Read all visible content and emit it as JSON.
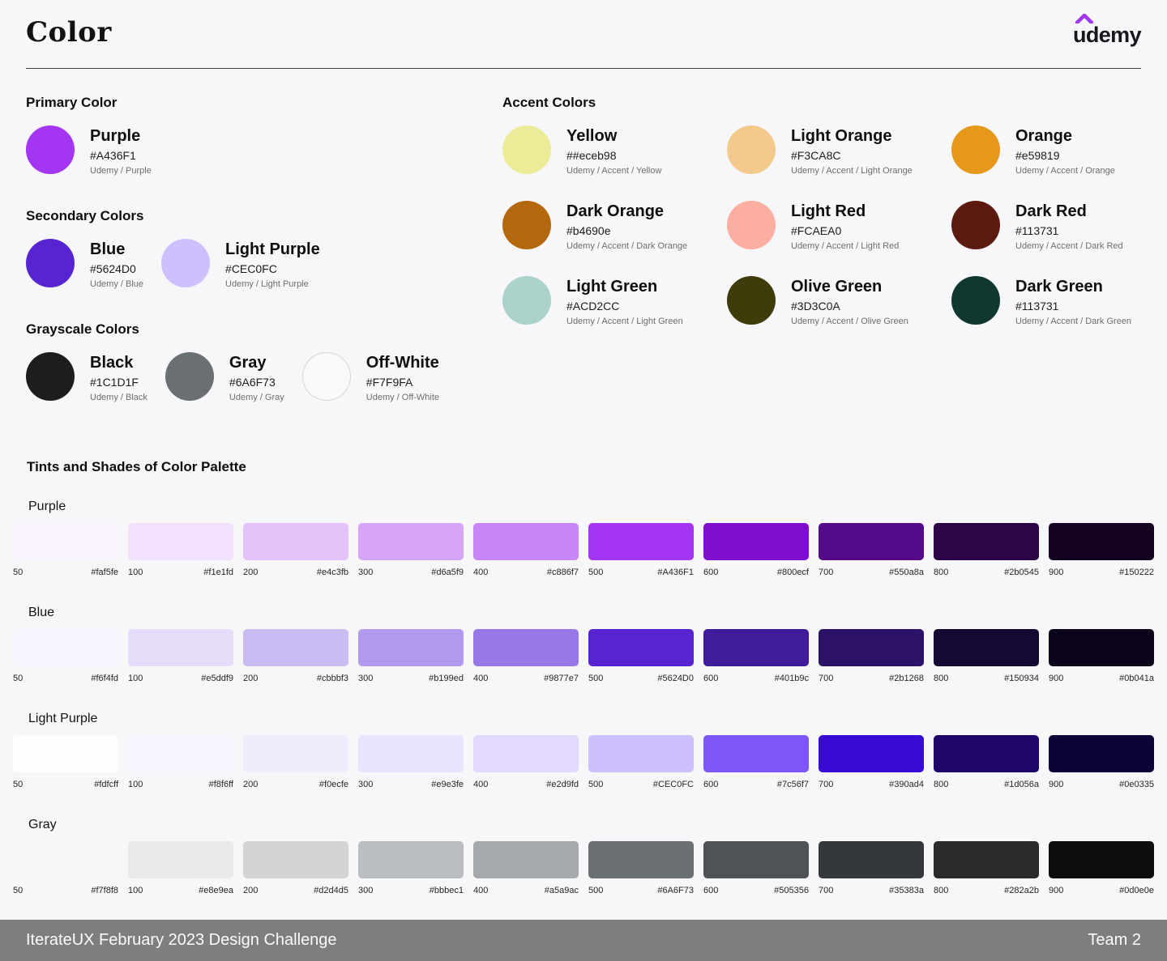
{
  "page": {
    "title": "Color"
  },
  "logo": {
    "wordmark": "udemy",
    "caret_color": "#A435F0"
  },
  "primary": {
    "heading": "Primary Color",
    "colors": [
      {
        "name": "Purple",
        "hex": "#A436F1",
        "swatch": "#A436F1",
        "path": "Udemy / Purple"
      }
    ]
  },
  "secondary": {
    "heading": "Secondary Colors",
    "colors": [
      {
        "name": "Blue",
        "hex": "#5624D0",
        "swatch": "#5624D0",
        "path": "Udemy / Blue"
      },
      {
        "name": "Light Purple",
        "hex": "#CEC0FC",
        "swatch": "#CEC0FC",
        "path": "Udemy / Light Purple"
      }
    ]
  },
  "grayscale": {
    "heading": "Grayscale Colors",
    "colors": [
      {
        "name": "Black",
        "hex": "#1C1D1F",
        "swatch": "#1C1D1F",
        "path": "Udemy / Black"
      },
      {
        "name": "Gray",
        "hex": "#6A6F73",
        "swatch": "#6A6F73",
        "path": "Udemy / Gray"
      },
      {
        "name": "Off-White",
        "hex": "#F7F9FA",
        "swatch": "#F7F9FA",
        "path": "Udemy / Off-White",
        "border": "#d5d7d9"
      }
    ]
  },
  "accent": {
    "heading": "Accent Colors",
    "colors": [
      {
        "name": "Yellow",
        "hex": "##eceb98",
        "swatch": "#eceb98",
        "path": "Udemy / Accent / Yellow"
      },
      {
        "name": "Light Orange",
        "hex": "#F3CA8C",
        "swatch": "#F3CA8C",
        "path": "Udemy / Accent / Light Orange"
      },
      {
        "name": "Orange",
        "hex": "#e59819",
        "swatch": "#e59819",
        "path": "Udemy / Accent / Orange"
      },
      {
        "name": "Dark Orange",
        "hex": "#b4690e",
        "swatch": "#b4690e",
        "path": "Udemy / Accent / Dark Orange"
      },
      {
        "name": "Light Red",
        "hex": "#FCAEA0",
        "swatch": "#FCAEA0",
        "path": "Udemy / Accent / Light Red"
      },
      {
        "name": "Dark Red",
        "hex": "#113731",
        "swatch": "#5b1b10",
        "path": "Udemy / Accent / Dark Red"
      },
      {
        "name": "Light Green",
        "hex": "#ACD2CC",
        "swatch": "#ACD2CC",
        "path": "Udemy / Accent / Light Green"
      },
      {
        "name": "Olive Green",
        "hex": "#3D3C0A",
        "swatch": "#3D3C0A",
        "path": "Udemy / Accent / Olive Green"
      },
      {
        "name": "Dark Green",
        "hex": "#113731",
        "swatch": "#113731",
        "path": "Udemy / Accent / Dark Green"
      }
    ]
  },
  "tints": {
    "heading": "Tints and Shades of Color Palette",
    "rows": [
      {
        "name": "Purple",
        "steps": [
          {
            "scale": "50",
            "hex": "#faf5fe"
          },
          {
            "scale": "100",
            "hex": "#f1e1fd"
          },
          {
            "scale": "200",
            "hex": "#e4c3fb"
          },
          {
            "scale": "300",
            "hex": "#d6a5f9"
          },
          {
            "scale": "400",
            "hex": "#c886f7"
          },
          {
            "scale": "500",
            "hex": "#A436F1"
          },
          {
            "scale": "600",
            "hex": "#800ecf"
          },
          {
            "scale": "700",
            "hex": "#550a8a"
          },
          {
            "scale": "800",
            "hex": "#2b0545"
          },
          {
            "scale": "900",
            "hex": "#150222"
          }
        ]
      },
      {
        "name": "Blue",
        "steps": [
          {
            "scale": "50",
            "hex": "#f6f4fd"
          },
          {
            "scale": "100",
            "hex": "#e5ddf9"
          },
          {
            "scale": "200",
            "hex": "#cbbbf3"
          },
          {
            "scale": "300",
            "hex": "#b199ed"
          },
          {
            "scale": "400",
            "hex": "#9877e7"
          },
          {
            "scale": "500",
            "hex": "#5624D0"
          },
          {
            "scale": "600",
            "hex": "#401b9c"
          },
          {
            "scale": "700",
            "hex": "#2b1268"
          },
          {
            "scale": "800",
            "hex": "#150934"
          },
          {
            "scale": "900",
            "hex": "#0b041a"
          }
        ]
      },
      {
        "name": "Light Purple",
        "steps": [
          {
            "scale": "50",
            "hex": "#fdfcff"
          },
          {
            "scale": "100",
            "hex": "#f8f6ff"
          },
          {
            "scale": "200",
            "hex": "#f0ecfe"
          },
          {
            "scale": "300",
            "hex": "#e9e3fe"
          },
          {
            "scale": "400",
            "hex": "#e2d9fd"
          },
          {
            "scale": "500",
            "hex": "#CEC0FC"
          },
          {
            "scale": "600",
            "hex": "#7c56f7"
          },
          {
            "scale": "700",
            "hex": "#390ad4"
          },
          {
            "scale": "800",
            "hex": "#1d056a"
          },
          {
            "scale": "900",
            "hex": "#0e0335"
          }
        ]
      },
      {
        "name": "Gray",
        "steps": [
          {
            "scale": "50",
            "hex": "#f7f8f8"
          },
          {
            "scale": "100",
            "hex": "#e8e9ea"
          },
          {
            "scale": "200",
            "hex": "#d2d4d5"
          },
          {
            "scale": "300",
            "hex": "#bbbec1"
          },
          {
            "scale": "400",
            "hex": "#a5a9ac"
          },
          {
            "scale": "500",
            "hex": "#6A6F73"
          },
          {
            "scale": "600",
            "hex": "#505356"
          },
          {
            "scale": "700",
            "hex": "#35383a"
          },
          {
            "scale": "800",
            "hex": "#282a2b"
          },
          {
            "scale": "900",
            "hex": "#0d0e0e"
          }
        ]
      }
    ]
  },
  "footer": {
    "left": "IterateUX February 2023 Design Challenge",
    "right": "Team 2"
  }
}
